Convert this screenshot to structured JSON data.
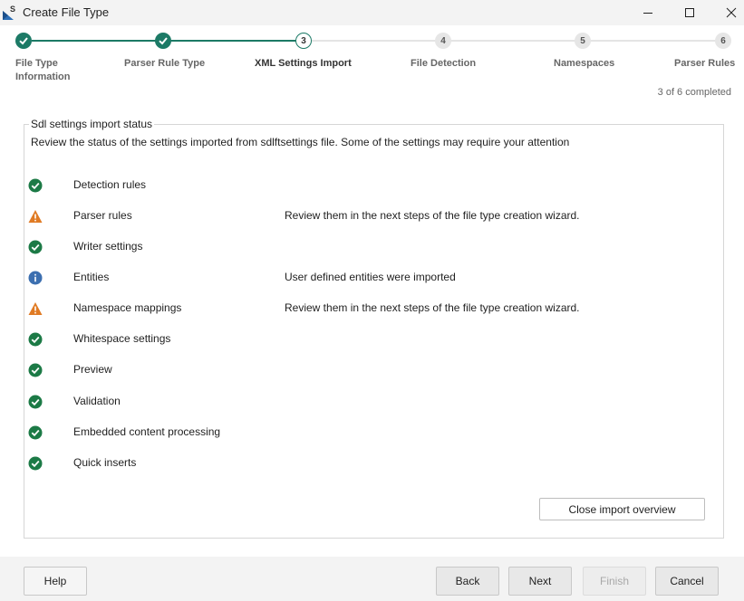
{
  "window": {
    "title": "Create File Type"
  },
  "stepper": {
    "steps": [
      {
        "number": "1",
        "label_line1": "File Type",
        "label_line2": "Information",
        "state": "done"
      },
      {
        "number": "2",
        "label_line1": "Parser Rule Type",
        "label_line2": "",
        "state": "done"
      },
      {
        "number": "3",
        "label_line1": "XML Settings Import",
        "label_line2": "",
        "state": "current"
      },
      {
        "number": "4",
        "label_line1": "File Detection",
        "label_line2": "",
        "state": "todo"
      },
      {
        "number": "5",
        "label_line1": "Namespaces",
        "label_line2": "",
        "state": "todo"
      },
      {
        "number": "6",
        "label_line1": "Parser Rules",
        "label_line2": "",
        "state": "todo"
      }
    ],
    "progress_text": "3 of 6 completed"
  },
  "import_status": {
    "legend": "Sdl settings import status",
    "description": "Review the status of the settings imported from sdlftsettings file. Some of the settings may require your attention",
    "items": [
      {
        "status": "success",
        "name": "Detection rules",
        "message": ""
      },
      {
        "status": "warning",
        "name": "Parser rules",
        "message": "Review them in the next steps of the file type creation wizard."
      },
      {
        "status": "success",
        "name": "Writer settings",
        "message": ""
      },
      {
        "status": "info",
        "name": "Entities",
        "message": "User defined entities were imported"
      },
      {
        "status": "warning",
        "name": "Namespace mappings",
        "message": "Review them in the next steps of the file type creation wizard."
      },
      {
        "status": "success",
        "name": "Whitespace settings",
        "message": ""
      },
      {
        "status": "success",
        "name": "Preview",
        "message": ""
      },
      {
        "status": "success",
        "name": "Validation",
        "message": ""
      },
      {
        "status": "success",
        "name": "Embedded content processing",
        "message": ""
      },
      {
        "status": "success",
        "name": "Quick inserts",
        "message": ""
      }
    ],
    "close_button": "Close import overview"
  },
  "footer": {
    "help": "Help",
    "back": "Back",
    "next": "Next",
    "finish": "Finish",
    "cancel": "Cancel"
  },
  "colors": {
    "accent": "#1c7a66",
    "success": "#1c7a46",
    "warning": "#e07b24",
    "info": "#3c6fb0"
  }
}
